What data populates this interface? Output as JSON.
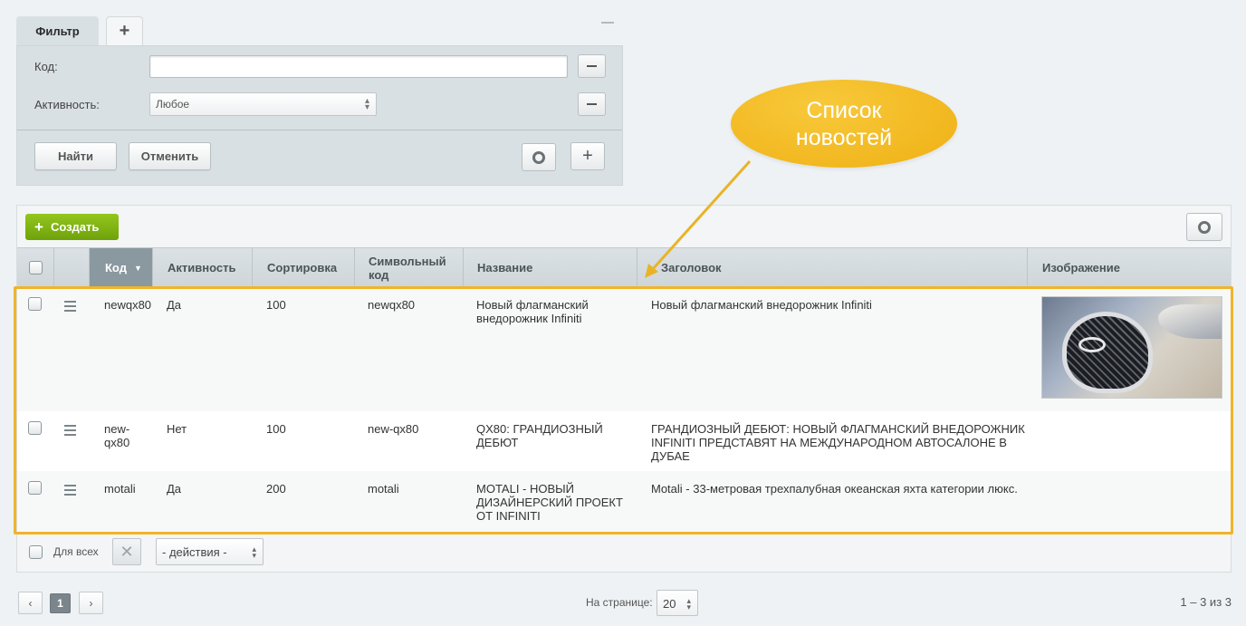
{
  "filter": {
    "tab_label": "Фильтр",
    "add_tab_label": "+",
    "fields": [
      {
        "label": "Код:",
        "value": ""
      },
      {
        "label": "Активность:",
        "value": "Любое"
      }
    ],
    "find_label": "Найти",
    "cancel_label": "Отменить"
  },
  "toolbar": {
    "create_label": "Создать"
  },
  "table": {
    "columns": [
      "Код",
      "Активность",
      "Сортировка",
      "Символьный код",
      "Название",
      "Заголовок",
      "Изображение"
    ],
    "sorted_column": "Код",
    "rows": [
      {
        "code": "newqx80",
        "active": "Да",
        "sort": "100",
        "symbol": "newqx80",
        "name": "Новый флагманский внедорожник Infiniti",
        "title": "Новый флагманский внедорожник Infiniti",
        "image": "infiniti-grille-photo"
      },
      {
        "code": "new-qx80",
        "active": "Нет",
        "sort": "100",
        "symbol": "new-qx80",
        "name": "QX80: ГРАНДИОЗНЫЙ ДЕБЮТ",
        "title": "ГРАНДИОЗНЫЙ ДЕБЮТ: НОВЫЙ ФЛАГМАНСКИЙ ВНЕДОРОЖНИК INFINITI ПРЕДСТАВЯТ НА МЕЖДУНАРОДНОМ АВТОСАЛОНЕ В ДУБАЕ",
        "image": ""
      },
      {
        "code": "motali",
        "active": "Да",
        "sort": "200",
        "symbol": "motali",
        "name": "MOTALI - НОВЫЙ ДИЗАЙНЕРСКИЙ ПРОЕКТ ОТ INFINITI",
        "title": "Motali - 33-метровая трехпалубная океанская яхта категории люкс.",
        "image": ""
      }
    ]
  },
  "footer": {
    "for_all_label": "Для всех",
    "actions_value": "- действия -"
  },
  "pagination": {
    "current_page": "1",
    "per_page_label": "На странице:",
    "per_page_value": "20",
    "range_text": "1 – 3 из 3"
  },
  "callout": {
    "line1": "Список",
    "line2": "новостей"
  },
  "colors": {
    "accent_green": "#7fb415",
    "highlight": "#f0b429",
    "header_sorted": "#8a989f"
  }
}
